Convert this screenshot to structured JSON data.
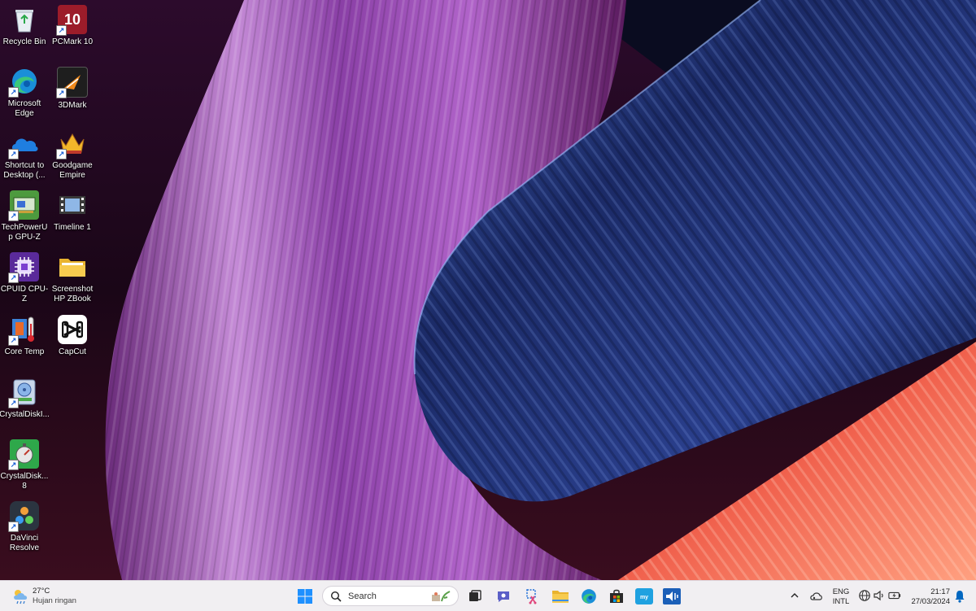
{
  "desktop": {
    "icons": [
      {
        "label": "Recycle Bin",
        "icon": "recycle-bin-icon"
      },
      {
        "label": "PCMark 10",
        "icon": "pcmark10-icon"
      },
      {
        "label": "Microsoft Edge",
        "icon": "edge-icon"
      },
      {
        "label": "3DMark",
        "icon": "3dmark-icon"
      },
      {
        "label": "Shortcut to Desktop (...",
        "icon": "onedrive-icon"
      },
      {
        "label": "Goodgame Empire",
        "icon": "goodgame-empire-icon"
      },
      {
        "label": "TechPowerUp GPU-Z",
        "icon": "gpuz-icon"
      },
      {
        "label": "Timeline 1",
        "icon": "timeline-icon"
      },
      {
        "label": "CPUID CPU-Z",
        "icon": "cpuz-icon"
      },
      {
        "label": "Screenshot HP ZBook",
        "icon": "folder-icon"
      },
      {
        "label": "Core Temp",
        "icon": "core-temp-icon"
      },
      {
        "label": "CapCut",
        "icon": "capcut-icon"
      },
      {
        "label": "CrystalDiskI...",
        "icon": "crystaldiskinfo-icon"
      },
      {
        "label": "CrystalDisk... 8",
        "icon": "crystaldiskmark-icon"
      },
      {
        "label": "DaVinci Resolve",
        "icon": "davinci-resolve-icon"
      }
    ]
  },
  "taskbar": {
    "weather": {
      "temp": "27°C",
      "condition": "Hujan ringan",
      "icon": "weather-rain-icon"
    },
    "search": {
      "placeholder": "Search"
    },
    "apps": [
      {
        "name": "start",
        "icon": "windows-start-icon"
      },
      {
        "name": "task-view",
        "icon": "task-view-icon"
      },
      {
        "name": "chat",
        "icon": "chat-icon"
      },
      {
        "name": "snipping-tool",
        "icon": "snipping-tool-icon"
      },
      {
        "name": "file-explorer",
        "icon": "file-explorer-icon"
      },
      {
        "name": "edge",
        "icon": "edge-icon"
      },
      {
        "name": "store",
        "icon": "store-icon"
      },
      {
        "name": "mydigi",
        "icon": "mydigi-icon"
      },
      {
        "name": "audio-app",
        "icon": "audio-app-icon"
      }
    ],
    "tray": {
      "language": {
        "line1": "ENG",
        "line2": "INTL"
      },
      "clock": {
        "time": "21:17",
        "date": "27/03/2024"
      }
    }
  },
  "colors": {
    "taskbar_bg": "#f1eff2",
    "accent_blue": "#0067c0"
  }
}
